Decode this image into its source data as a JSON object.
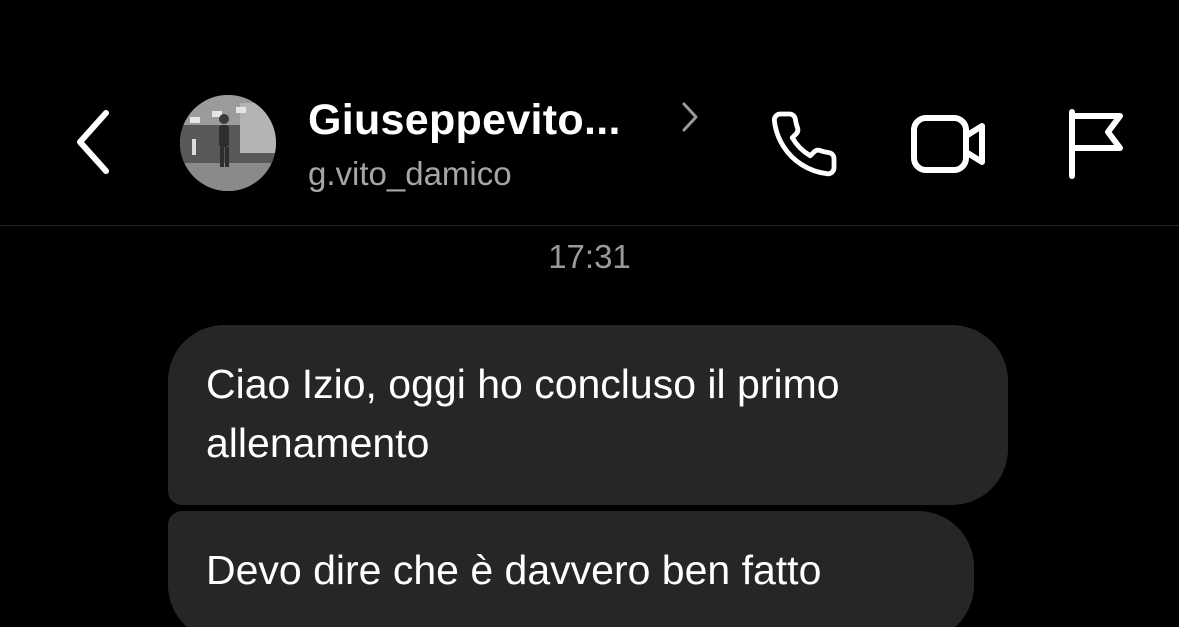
{
  "header": {
    "contact_name": "Giuseppevito...",
    "username": "g.vito_damico",
    "icons": {
      "back": "chevron-left-icon",
      "profile_link": "chevron-right-icon",
      "call": "phone-icon",
      "video": "video-camera-icon",
      "report": "flag-icon"
    }
  },
  "conversation": {
    "timestamp": "17:31",
    "messages": [
      {
        "text": "Ciao Izio, oggi ho concluso il primo allenamento"
      },
      {
        "text": "Devo dire che è davvero ben fatto"
      }
    ]
  },
  "colors": {
    "background": "#000000",
    "bubble": "#262626",
    "text_primary": "#ffffff",
    "text_secondary": "#a6a6a6"
  }
}
